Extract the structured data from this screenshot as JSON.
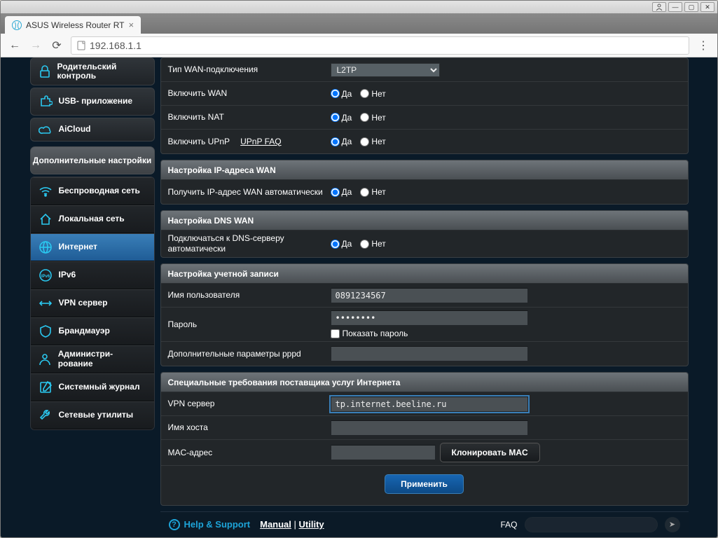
{
  "browser": {
    "tab_title": "ASUS Wireless Router RT",
    "url": "192.168.1.1"
  },
  "sidebar": {
    "top": [
      {
        "label": "Родительский контроль",
        "icon": "lock"
      },
      {
        "label": "USB- приложение",
        "icon": "puzzle"
      },
      {
        "label": "AiCloud",
        "icon": "cloud"
      }
    ],
    "section_title": "Дополнительные настройки",
    "items": [
      {
        "label": "Беспроводная сеть",
        "icon": "wifi"
      },
      {
        "label": "Локальная сеть",
        "icon": "home"
      },
      {
        "label": "Интернет",
        "icon": "globe",
        "active": true
      },
      {
        "label": "IPv6",
        "icon": "ipv6"
      },
      {
        "label": "VPN сервер",
        "icon": "vpn"
      },
      {
        "label": "Брандмауэр",
        "icon": "shield"
      },
      {
        "label": "Администри- рование",
        "icon": "admin"
      },
      {
        "label": "Системный журнал",
        "icon": "log"
      },
      {
        "label": "Сетевые утилиты",
        "icon": "tools"
      }
    ]
  },
  "radio_labels": {
    "yes": "Да",
    "no": "Нет"
  },
  "panels": {
    "basic": {
      "wan_type_label": "Тип WAN-подключения",
      "wan_type_value": "L2TP",
      "enable_wan_label": "Включить WAN",
      "enable_nat_label": "Включить NAT",
      "enable_upnp_label": "Включить UPnP",
      "upnp_faq": "UPnP  FAQ"
    },
    "ip": {
      "title": "Настройка IP-адреса WAN",
      "auto_label": "Получить IP-адрес WAN автоматически"
    },
    "dns": {
      "title": "Настройка DNS WAN",
      "auto_label": "Подключаться к DNS-серверу автоматически"
    },
    "account": {
      "title": "Настройка учетной записи",
      "username_label": "Имя пользователя",
      "username_value": "0891234567",
      "password_label": "Пароль",
      "password_value": "••••••••",
      "show_pw_label": "Показать пароль",
      "pppd_label": "Дополнительные параметры pppd"
    },
    "isp": {
      "title": "Специальные требования поставщика услуг Интернета",
      "vpn_label": "VPN сервер",
      "vpn_value": "tp.internet.beeline.ru",
      "hostname_label": "Имя хоста",
      "mac_label": "MAC-адрес",
      "clone_mac": "Клонировать MAC"
    }
  },
  "apply_label": "Применить",
  "footer": {
    "help": "Help & Support",
    "manual": "Manual",
    "utility": "Utility",
    "faq": "FAQ"
  }
}
